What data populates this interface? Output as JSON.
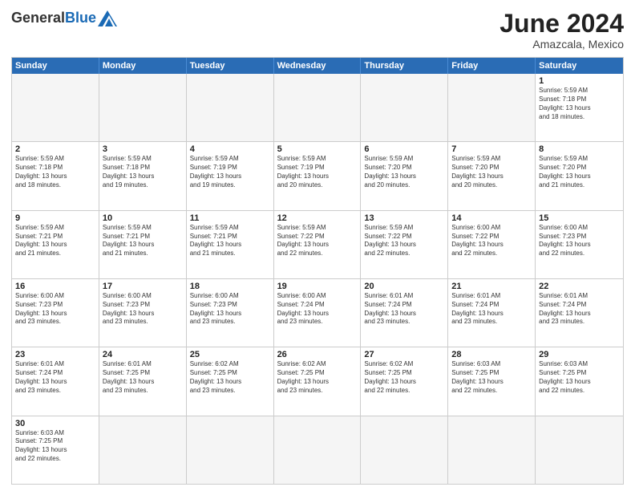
{
  "header": {
    "logo_general": "General",
    "logo_blue": "Blue",
    "month_year": "June 2024",
    "location": "Amazcala, Mexico"
  },
  "days_of_week": [
    "Sunday",
    "Monday",
    "Tuesday",
    "Wednesday",
    "Thursday",
    "Friday",
    "Saturday"
  ],
  "weeks": [
    [
      {
        "day": "",
        "info": ""
      },
      {
        "day": "",
        "info": ""
      },
      {
        "day": "",
        "info": ""
      },
      {
        "day": "",
        "info": ""
      },
      {
        "day": "",
        "info": ""
      },
      {
        "day": "",
        "info": ""
      },
      {
        "day": "1",
        "info": "Sunrise: 5:59 AM\nSunset: 7:18 PM\nDaylight: 13 hours\nand 18 minutes."
      }
    ],
    [
      {
        "day": "2",
        "info": "Sunrise: 5:59 AM\nSunset: 7:18 PM\nDaylight: 13 hours\nand 18 minutes."
      },
      {
        "day": "3",
        "info": "Sunrise: 5:59 AM\nSunset: 7:18 PM\nDaylight: 13 hours\nand 19 minutes."
      },
      {
        "day": "4",
        "info": "Sunrise: 5:59 AM\nSunset: 7:19 PM\nDaylight: 13 hours\nand 19 minutes."
      },
      {
        "day": "5",
        "info": "Sunrise: 5:59 AM\nSunset: 7:19 PM\nDaylight: 13 hours\nand 20 minutes."
      },
      {
        "day": "6",
        "info": "Sunrise: 5:59 AM\nSunset: 7:20 PM\nDaylight: 13 hours\nand 20 minutes."
      },
      {
        "day": "7",
        "info": "Sunrise: 5:59 AM\nSunset: 7:20 PM\nDaylight: 13 hours\nand 20 minutes."
      },
      {
        "day": "8",
        "info": "Sunrise: 5:59 AM\nSunset: 7:20 PM\nDaylight: 13 hours\nand 21 minutes."
      }
    ],
    [
      {
        "day": "9",
        "info": "Sunrise: 5:59 AM\nSunset: 7:21 PM\nDaylight: 13 hours\nand 21 minutes."
      },
      {
        "day": "10",
        "info": "Sunrise: 5:59 AM\nSunset: 7:21 PM\nDaylight: 13 hours\nand 21 minutes."
      },
      {
        "day": "11",
        "info": "Sunrise: 5:59 AM\nSunset: 7:21 PM\nDaylight: 13 hours\nand 21 minutes."
      },
      {
        "day": "12",
        "info": "Sunrise: 5:59 AM\nSunset: 7:22 PM\nDaylight: 13 hours\nand 22 minutes."
      },
      {
        "day": "13",
        "info": "Sunrise: 5:59 AM\nSunset: 7:22 PM\nDaylight: 13 hours\nand 22 minutes."
      },
      {
        "day": "14",
        "info": "Sunrise: 6:00 AM\nSunset: 7:22 PM\nDaylight: 13 hours\nand 22 minutes."
      },
      {
        "day": "15",
        "info": "Sunrise: 6:00 AM\nSunset: 7:23 PM\nDaylight: 13 hours\nand 22 minutes."
      }
    ],
    [
      {
        "day": "16",
        "info": "Sunrise: 6:00 AM\nSunset: 7:23 PM\nDaylight: 13 hours\nand 23 minutes."
      },
      {
        "day": "17",
        "info": "Sunrise: 6:00 AM\nSunset: 7:23 PM\nDaylight: 13 hours\nand 23 minutes."
      },
      {
        "day": "18",
        "info": "Sunrise: 6:00 AM\nSunset: 7:23 PM\nDaylight: 13 hours\nand 23 minutes."
      },
      {
        "day": "19",
        "info": "Sunrise: 6:00 AM\nSunset: 7:24 PM\nDaylight: 13 hours\nand 23 minutes."
      },
      {
        "day": "20",
        "info": "Sunrise: 6:01 AM\nSunset: 7:24 PM\nDaylight: 13 hours\nand 23 minutes."
      },
      {
        "day": "21",
        "info": "Sunrise: 6:01 AM\nSunset: 7:24 PM\nDaylight: 13 hours\nand 23 minutes."
      },
      {
        "day": "22",
        "info": "Sunrise: 6:01 AM\nSunset: 7:24 PM\nDaylight: 13 hours\nand 23 minutes."
      }
    ],
    [
      {
        "day": "23",
        "info": "Sunrise: 6:01 AM\nSunset: 7:24 PM\nDaylight: 13 hours\nand 23 minutes."
      },
      {
        "day": "24",
        "info": "Sunrise: 6:01 AM\nSunset: 7:25 PM\nDaylight: 13 hours\nand 23 minutes."
      },
      {
        "day": "25",
        "info": "Sunrise: 6:02 AM\nSunset: 7:25 PM\nDaylight: 13 hours\nand 23 minutes."
      },
      {
        "day": "26",
        "info": "Sunrise: 6:02 AM\nSunset: 7:25 PM\nDaylight: 13 hours\nand 23 minutes."
      },
      {
        "day": "27",
        "info": "Sunrise: 6:02 AM\nSunset: 7:25 PM\nDaylight: 13 hours\nand 22 minutes."
      },
      {
        "day": "28",
        "info": "Sunrise: 6:03 AM\nSunset: 7:25 PM\nDaylight: 13 hours\nand 22 minutes."
      },
      {
        "day": "29",
        "info": "Sunrise: 6:03 AM\nSunset: 7:25 PM\nDaylight: 13 hours\nand 22 minutes."
      }
    ],
    [
      {
        "day": "30",
        "info": "Sunrise: 6:03 AM\nSunset: 7:25 PM\nDaylight: 13 hours\nand 22 minutes."
      },
      {
        "day": "",
        "info": ""
      },
      {
        "day": "",
        "info": ""
      },
      {
        "day": "",
        "info": ""
      },
      {
        "day": "",
        "info": ""
      },
      {
        "day": "",
        "info": ""
      },
      {
        "day": "",
        "info": ""
      }
    ]
  ]
}
